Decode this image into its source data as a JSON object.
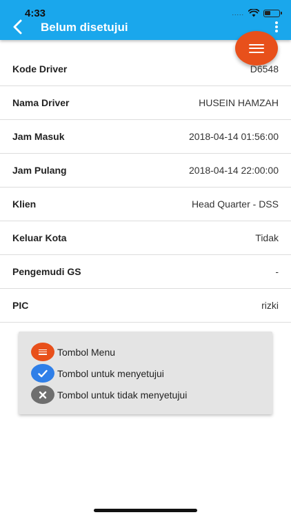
{
  "status_bar": {
    "time": "4:33",
    "signal": "....."
  },
  "header": {
    "title": "Belum disetujui"
  },
  "details": [
    {
      "label": "Kode Driver",
      "value": "D6548"
    },
    {
      "label": "Nama Driver",
      "value": "HUSEIN HAMZAH"
    },
    {
      "label": "Jam Masuk",
      "value": "2018-04-14 01:56:00"
    },
    {
      "label": "Jam Pulang",
      "value": "2018-04-14 22:00:00"
    },
    {
      "label": "Klien",
      "value": "Head Quarter - DSS"
    },
    {
      "label": "Keluar Kota",
      "value": "Tidak"
    },
    {
      "label": "Pengemudi GS",
      "value": "-"
    },
    {
      "label": "PIC",
      "value": "rizki"
    }
  ],
  "legend": {
    "menu_label": "Tombol Menu",
    "approve_label": "Tombol untuk menyetujui",
    "reject_label": "Tombol untuk tidak menyetujui"
  },
  "colors": {
    "appbar": "#1aa7ec",
    "menu_fab": "#e8501b",
    "approve": "#2f7fe8",
    "reject": "#6e6e6e"
  },
  "icons": {
    "back": "arrow-left-icon",
    "more": "more-vertical-icon",
    "menu": "hamburger-icon",
    "approve": "check-icon",
    "reject": "close-icon"
  }
}
